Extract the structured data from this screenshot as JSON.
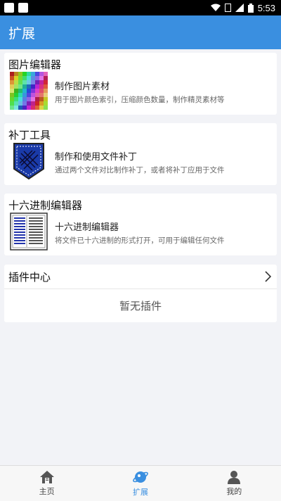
{
  "status": {
    "time": "5:53"
  },
  "appbar": {
    "title": "扩展"
  },
  "sections": {
    "image_editor": {
      "title": "图片编辑器",
      "item_title": "制作图片素材",
      "item_desc": "用于图片颜色索引，压缩颜色数量，制作精灵素材等"
    },
    "patch_tool": {
      "title": "补丁工具",
      "item_title": "制作和使用文件补丁",
      "item_desc": "通过两个文件对比制作补丁，或者将补丁应用于文件"
    },
    "hex_editor": {
      "title": "十六进制编辑器",
      "item_title": "十六进制编辑器",
      "item_desc": "将文件已十六进制的形式打开，可用于编辑任何文件"
    }
  },
  "plugins": {
    "title": "插件中心",
    "empty": "暂无插件"
  },
  "bottom_nav": {
    "home": "主页",
    "extend": "扩展",
    "mine": "我的"
  },
  "colors": {
    "accent": "#3a8fe0",
    "background": "#f2f3f7"
  }
}
